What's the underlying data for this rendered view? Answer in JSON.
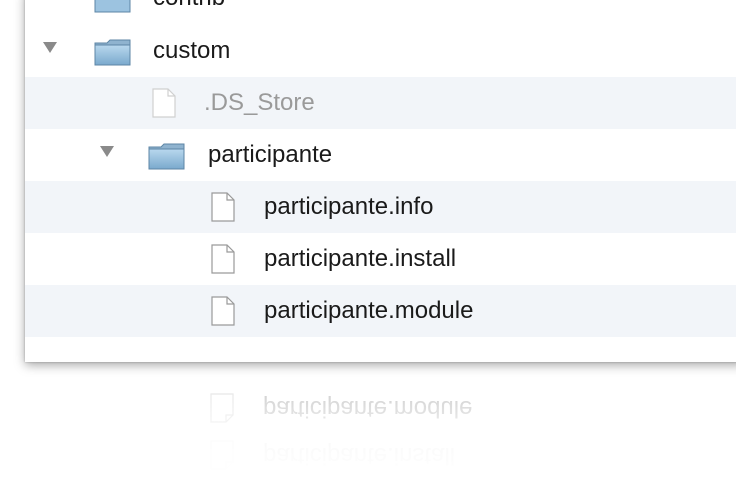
{
  "tree": {
    "rows": [
      {
        "name": "contrib",
        "kind": "folder"
      },
      {
        "name": "custom",
        "kind": "folder",
        "expanded": true
      },
      {
        "name": ".DS_Store",
        "kind": "file",
        "hidden": true
      },
      {
        "name": "participante",
        "kind": "folder",
        "expanded": true
      },
      {
        "name": "participante.info",
        "kind": "file"
      },
      {
        "name": "participante.install",
        "kind": "file"
      },
      {
        "name": "participante.module",
        "kind": "file"
      }
    ]
  },
  "reflection": {
    "rows": [
      "participante.module",
      "participante.install"
    ]
  },
  "colors": {
    "stripe": "#f2f5f9",
    "folder_blue": "#8fb8d6",
    "text": "#1a1a1a",
    "dim_text": "#9a9a9a"
  },
  "icons": {
    "folder": "folder-icon",
    "file": "document-icon",
    "disclosure": "disclosure-triangle-icon"
  }
}
